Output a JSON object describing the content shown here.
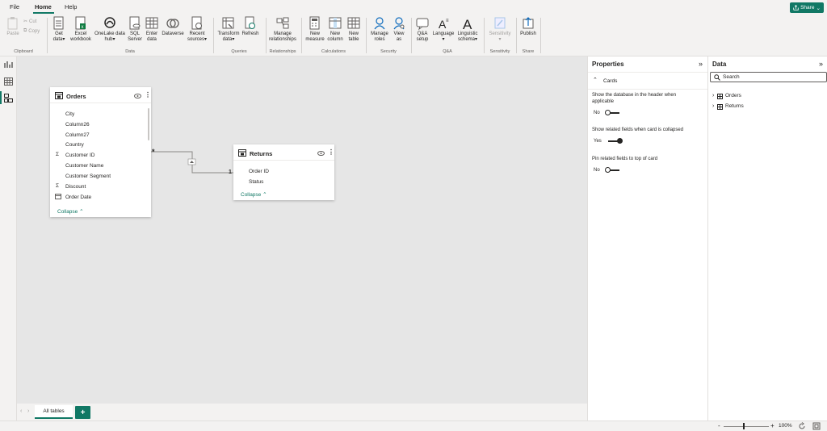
{
  "menu": {
    "tabs": [
      "File",
      "Home",
      "Help"
    ],
    "share_label": "Share"
  },
  "ribbon": {
    "clipboard": {
      "paste": "Paste",
      "cut": "Cut",
      "copy": "Copy",
      "group": "Clipboard"
    },
    "data": {
      "get_data": [
        "Get",
        "data"
      ],
      "excel": [
        "Excel",
        "workbook"
      ],
      "onelake": [
        "OneLake data",
        "hub"
      ],
      "sql": [
        "SQL",
        "Server"
      ],
      "enter": [
        "Enter",
        "data"
      ],
      "dataverse": "Dataverse",
      "recent": [
        "Recent",
        "sources"
      ],
      "group": "Data"
    },
    "queries": {
      "transform": [
        "Transform",
        "data"
      ],
      "refresh": "Refresh",
      "group": "Queries"
    },
    "relationships": {
      "manage": [
        "Manage",
        "relationships"
      ],
      "group": "Relationships"
    },
    "calculations": {
      "new_measure": [
        "New",
        "measure"
      ],
      "new_column": [
        "New",
        "column"
      ],
      "new_table": [
        "New",
        "table"
      ],
      "group": "Calculations"
    },
    "security": {
      "manage_roles": [
        "Manage",
        "roles"
      ],
      "view_as": [
        "View",
        "as"
      ],
      "group": "Security"
    },
    "qa": {
      "qa_setup": [
        "Q&A",
        "setup"
      ],
      "language": "Language",
      "linguistic": [
        "Linguistic",
        "schema"
      ],
      "group": "Q&A"
    },
    "sensitivity": {
      "label": "Sensitivity",
      "group": "Sensitivity"
    },
    "share": {
      "publish": "Publish",
      "group": "Share"
    }
  },
  "canvas": {
    "orders": {
      "title": "Orders",
      "fields": [
        "City",
        "Column26",
        "Column27",
        "Country",
        "Customer ID",
        "Customer Name",
        "Customer Segment",
        "Discount",
        "Order Date"
      ],
      "collapse": "Collapse"
    },
    "returns": {
      "title": "Returns",
      "fields": [
        "Order ID",
        "Status"
      ],
      "collapse": "Collapse"
    },
    "relationship": {
      "many": "*",
      "one": "1"
    }
  },
  "bottom": {
    "tab_label": "All tables",
    "add_label": "+"
  },
  "status": {
    "zoom": "100%",
    "minus": "-",
    "plus": "+"
  },
  "properties": {
    "title": "Properties",
    "section": "Cards",
    "opt1": {
      "label": "Show the database in the header when applicable",
      "value": "No"
    },
    "opt2": {
      "label": "Show related fields when card is collapsed",
      "value": "Yes"
    },
    "opt3": {
      "label": "Pin related fields to top of card",
      "value": "No"
    }
  },
  "data_pane": {
    "title": "Data",
    "search_placeholder": "Search",
    "tables": [
      "Orders",
      "Returns"
    ]
  },
  "colors": {
    "accent": "#117865",
    "canvas": "#e6e6e6"
  }
}
